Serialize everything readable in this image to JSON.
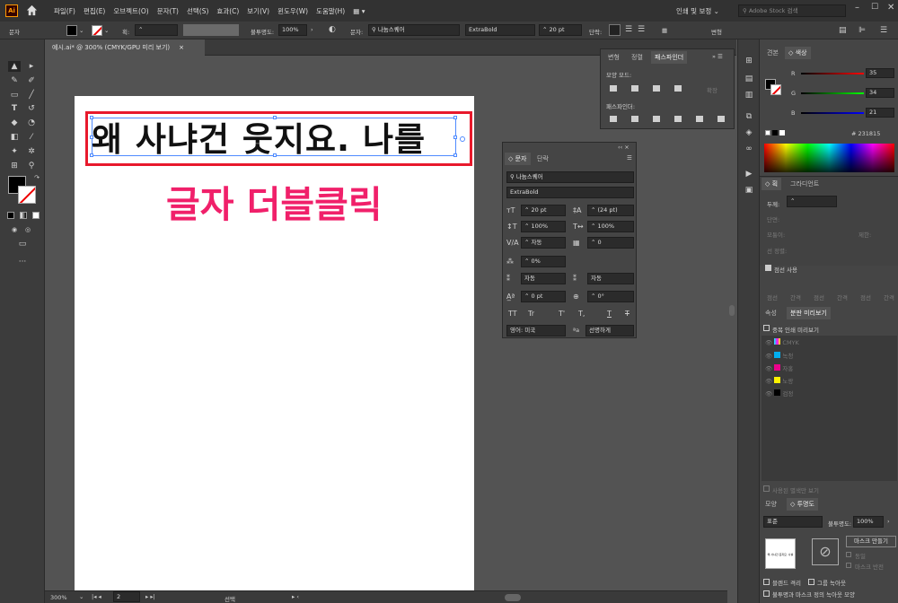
{
  "app": {
    "logo": "Ai"
  },
  "menu": [
    "파일(F)",
    "편집(E)",
    "오브젝트(O)",
    "문자(T)",
    "선택(S)",
    "효과(C)",
    "보기(V)",
    "윈도우(W)",
    "도움말(H)"
  ],
  "topright": {
    "workspace": "인쇄 및 보정",
    "stock_search": "Adobe Stock 검색"
  },
  "control": {
    "mode_label": "문자",
    "stroke_label": "획:",
    "opacity_label": "불투명도:",
    "opacity_value": "100%",
    "char_label": "문자:",
    "font_family": "나눔스퀘어",
    "font_style": "ExtraBold",
    "font_size": "20 pt",
    "paragraph_label": "단락:",
    "transform_label": "변형"
  },
  "document": {
    "tab_title": "예시.ai* @ 300% (CMYK/GPU 미리 보기)"
  },
  "canvas": {
    "text": "왜 사냐건 웃지요. 나를",
    "annotation": "글자 더블클릭",
    "colors": {
      "annotation": "#f0206a",
      "highlight_border": "#e8192c",
      "selection": "#4f8bff"
    }
  },
  "status": {
    "zoom": "300%",
    "artboard": "2",
    "tool": "선택"
  },
  "pathfinder_panel": {
    "tabs": [
      "변형",
      "정렬",
      "패스파인더"
    ],
    "shape_modes_label": "모양 모드:",
    "expand_label": "확장",
    "pathfinders_label": "패스파인더:"
  },
  "character_panel": {
    "tabs": [
      "문자",
      "단락"
    ],
    "font_family": "나눔스퀘어",
    "font_style": "ExtraBold",
    "size": "20 pt",
    "leading": "(24 pt)",
    "vscale": "100%",
    "hscale": "100%",
    "kerning": "자동",
    "tracking": "0",
    "tsume": "0%",
    "aki_left": "자동",
    "aki_right": "자동",
    "baseline": "0 pt",
    "rotation": "0°",
    "type_buttons": [
      "TT",
      "Tr",
      "T'",
      "T,",
      "T",
      "T"
    ],
    "language": "영어: 미국",
    "antialias": "선명하게"
  },
  "color_panel": {
    "tabs": [
      "견본",
      "색상"
    ],
    "r_label": "R",
    "g_label": "G",
    "b_label": "B",
    "r": "35",
    "g": "34",
    "b": "21",
    "hex": "231815",
    "color_values": {
      "fill": "#231815"
    }
  },
  "stroke_panel": {
    "tabs": [
      "획",
      "그라디언트"
    ],
    "weight_label": "두께:",
    "cap_label": "단면:",
    "corner_label": "모퉁이:",
    "limit_label": "제한:",
    "align_label": "선 정렬:",
    "dashed_label": "점선 사용",
    "dash_labels": [
      "점선",
      "간격",
      "점선",
      "간격",
      "점선",
      "간격"
    ]
  },
  "separations_panel": {
    "tabs": [
      "속성",
      "분판 미리보기"
    ],
    "overprint_label": "중복 인쇄 미리보기",
    "plates": [
      "CMYK",
      "녹청",
      "자홍",
      "노랑",
      "검정"
    ],
    "used_spots_label": "사용된 별색만 보기"
  },
  "transparency_panel": {
    "tabs": [
      "모양",
      "투명도"
    ],
    "blend_mode": "표준",
    "opacity_label": "불투명도:",
    "opacity_value": "100%",
    "make_mask": "마스크 만들기",
    "clip_label": "동일",
    "invert_label": "마스크 반전",
    "isolate_label": "블렌드 격리",
    "knockout_label": "그룹 녹아웃",
    "define_knockout": "불투명과 마스크 정의 녹아웃 모양",
    "thumb_text": "왜 사냐건 웃지요. 나를"
  }
}
